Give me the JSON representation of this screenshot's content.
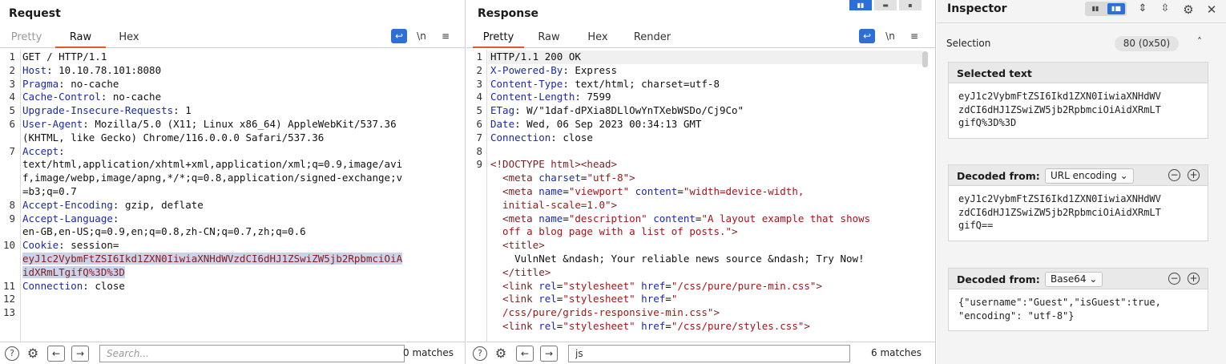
{
  "request": {
    "title": "Request",
    "tabs": [
      "Pretty",
      "Raw",
      "Hex"
    ],
    "active_tab": "Raw",
    "newline_label": "\\n",
    "lines": [
      {
        "n": "1",
        "segs": [
          {
            "t": "GET / HTTP/1.1",
            "c": ""
          }
        ]
      },
      {
        "n": "2",
        "segs": [
          {
            "t": "Host",
            "c": "hk"
          },
          {
            "t": ": 10.10.78.101:8080",
            "c": ""
          }
        ]
      },
      {
        "n": "3",
        "segs": [
          {
            "t": "Pragma",
            "c": "hk"
          },
          {
            "t": ": no-cache",
            "c": ""
          }
        ]
      },
      {
        "n": "4",
        "segs": [
          {
            "t": "Cache-Control",
            "c": "hk"
          },
          {
            "t": ": no-cache",
            "c": ""
          }
        ]
      },
      {
        "n": "5",
        "segs": [
          {
            "t": "Upgrade-Insecure-Requests",
            "c": "hk"
          },
          {
            "t": ": 1",
            "c": ""
          }
        ]
      },
      {
        "n": "6",
        "segs": [
          {
            "t": "User-Agent",
            "c": "hk"
          },
          {
            "t": ": Mozilla/5.0 (X11; Linux x86_64) AppleWebKit/537.36",
            "c": ""
          }
        ]
      },
      {
        "n": "",
        "segs": [
          {
            "t": "(KHTML, like Gecko) Chrome/116.0.0.0 Safari/537.36",
            "c": ""
          }
        ]
      },
      {
        "n": "7",
        "segs": [
          {
            "t": "Accept",
            "c": "hk"
          },
          {
            "t": ":",
            "c": ""
          }
        ]
      },
      {
        "n": "",
        "segs": [
          {
            "t": "text/html,application/xhtml+xml,application/xml;q=0.9,image/avi",
            "c": ""
          }
        ]
      },
      {
        "n": "",
        "segs": [
          {
            "t": "f,image/webp,image/apng,*/*;q=0.8,application/signed-exchange;v",
            "c": ""
          }
        ]
      },
      {
        "n": "",
        "segs": [
          {
            "t": "=b3;q=0.7",
            "c": ""
          }
        ]
      },
      {
        "n": "8",
        "segs": [
          {
            "t": "Accept-Encoding",
            "c": "hk"
          },
          {
            "t": ": gzip, deflate",
            "c": ""
          }
        ]
      },
      {
        "n": "9",
        "segs": [
          {
            "t": "Accept-Language",
            "c": "hk"
          },
          {
            "t": ":",
            "c": ""
          }
        ]
      },
      {
        "n": "",
        "segs": [
          {
            "t": "en-GB,en-US;q=0.9,en;q=0.8,zh-CN;q=0.7,zh;q=0.6",
            "c": ""
          }
        ]
      },
      {
        "n": "10",
        "segs": [
          {
            "t": "Cookie",
            "c": "hk"
          },
          {
            "t": ": session=",
            "c": ""
          }
        ]
      },
      {
        "n": "",
        "segs": [
          {
            "t": "eyJ1c2VybmFtZSI6Ikd1ZXN0IiwiaXNHdWVzdCI6dHJ1ZSwiZW5jb2RpbmciOiA",
            "c": "sel"
          }
        ]
      },
      {
        "n": "",
        "segs": [
          {
            "t": "idXRmLTgifQ%3D%3D",
            "c": "sel"
          }
        ]
      },
      {
        "n": "11",
        "segs": [
          {
            "t": "Connection",
            "c": "hk"
          },
          {
            "t": ": close",
            "c": ""
          }
        ]
      },
      {
        "n": "12",
        "segs": []
      },
      {
        "n": "13",
        "segs": []
      }
    ],
    "search_placeholder": "Search...",
    "search_value": "",
    "matches": "0 matches"
  },
  "response": {
    "title": "Response",
    "tabs": [
      "Pretty",
      "Raw",
      "Hex",
      "Render"
    ],
    "active_tab": "Pretty",
    "newline_label": "\\n",
    "lines": [
      {
        "n": "1",
        "segs": [
          {
            "t": "HTTP/1.1 200 OK",
            "c": ""
          }
        ]
      },
      {
        "n": "2",
        "segs": [
          {
            "t": "X-Powered-By",
            "c": "hk"
          },
          {
            "t": ": Express",
            "c": ""
          }
        ]
      },
      {
        "n": "3",
        "segs": [
          {
            "t": "Content-Type",
            "c": "hk"
          },
          {
            "t": ": text/html; charset=utf-8",
            "c": ""
          }
        ]
      },
      {
        "n": "4",
        "segs": [
          {
            "t": "Content-Length",
            "c": "hk"
          },
          {
            "t": ": 7599",
            "c": ""
          }
        ]
      },
      {
        "n": "5",
        "segs": [
          {
            "t": "ETag",
            "c": "hk"
          },
          {
            "t": ": W/\"1daf-dPXia8DLlOwYnTXebWSDo/Cj9Co\"",
            "c": ""
          }
        ]
      },
      {
        "n": "6",
        "segs": [
          {
            "t": "Date",
            "c": "hk"
          },
          {
            "t": ": Wed, 06 Sep 2023 00:34:13 GMT",
            "c": ""
          }
        ]
      },
      {
        "n": "7",
        "segs": [
          {
            "t": "Connection",
            "c": "hk"
          },
          {
            "t": ": close",
            "c": ""
          }
        ]
      },
      {
        "n": "8",
        "segs": []
      },
      {
        "n": "9",
        "segs": [
          {
            "t": "<!DOCTYPE html>",
            "c": "tag"
          },
          {
            "t": "<head>",
            "c": "tag"
          }
        ]
      },
      {
        "n": "",
        "segs": [
          {
            "t": "  <meta ",
            "c": "tag"
          },
          {
            "t": "charset",
            "c": "attr"
          },
          {
            "t": "=",
            "c": ""
          },
          {
            "t": "\"utf-8\"",
            "c": "aval"
          },
          {
            "t": ">",
            "c": "tag"
          }
        ]
      },
      {
        "n": "",
        "segs": [
          {
            "t": "  <meta ",
            "c": "tag"
          },
          {
            "t": "name",
            "c": "attr"
          },
          {
            "t": "=",
            "c": ""
          },
          {
            "t": "\"viewport\"",
            "c": "aval"
          },
          {
            "t": " content",
            "c": "attr"
          },
          {
            "t": "=",
            "c": ""
          },
          {
            "t": "\"width=device-width,",
            "c": "aval"
          }
        ]
      },
      {
        "n": "",
        "segs": [
          {
            "t": "  initial-scale=1.0\"",
            "c": "aval"
          },
          {
            "t": ">",
            "c": "tag"
          }
        ]
      },
      {
        "n": "",
        "segs": [
          {
            "t": "  <meta ",
            "c": "tag"
          },
          {
            "t": "name",
            "c": "attr"
          },
          {
            "t": "=",
            "c": ""
          },
          {
            "t": "\"description\"",
            "c": "aval"
          },
          {
            "t": " content",
            "c": "attr"
          },
          {
            "t": "=",
            "c": ""
          },
          {
            "t": "\"A layout example that shows",
            "c": "aval"
          }
        ]
      },
      {
        "n": "",
        "segs": [
          {
            "t": "  off a blog page with a list of posts.\"",
            "c": "aval"
          },
          {
            "t": ">",
            "c": "tag"
          }
        ]
      },
      {
        "n": "",
        "segs": [
          {
            "t": "  <title>",
            "c": "tag"
          }
        ]
      },
      {
        "n": "",
        "segs": [
          {
            "t": "    VulnNet &ndash; Your reliable news source &ndash; Try Now!",
            "c": ""
          }
        ]
      },
      {
        "n": "",
        "segs": [
          {
            "t": "  </title>",
            "c": "tag"
          }
        ]
      },
      {
        "n": "",
        "segs": [
          {
            "t": "  <link ",
            "c": "tag"
          },
          {
            "t": "rel",
            "c": "attr"
          },
          {
            "t": "=",
            "c": ""
          },
          {
            "t": "\"stylesheet\"",
            "c": "aval"
          },
          {
            "t": " href",
            "c": "attr"
          },
          {
            "t": "=",
            "c": ""
          },
          {
            "t": "\"/css/pure/pure-min.css\"",
            "c": "aval"
          },
          {
            "t": ">",
            "c": "tag"
          }
        ]
      },
      {
        "n": "",
        "segs": [
          {
            "t": "  <link ",
            "c": "tag"
          },
          {
            "t": "rel",
            "c": "attr"
          },
          {
            "t": "=",
            "c": ""
          },
          {
            "t": "\"stylesheet\"",
            "c": "aval"
          },
          {
            "t": " href",
            "c": "attr"
          },
          {
            "t": "=",
            "c": ""
          },
          {
            "t": "\"",
            "c": "aval"
          }
        ]
      },
      {
        "n": "",
        "segs": [
          {
            "t": "  /css/pure/grids-responsive-min.css\"",
            "c": "aval"
          },
          {
            "t": ">",
            "c": "tag"
          }
        ]
      },
      {
        "n": "",
        "segs": [
          {
            "t": "  <link ",
            "c": "tag"
          },
          {
            "t": "rel",
            "c": "attr"
          },
          {
            "t": "=",
            "c": ""
          },
          {
            "t": "\"stylesheet\"",
            "c": "aval"
          },
          {
            "t": " href",
            "c": "attr"
          },
          {
            "t": "=",
            "c": ""
          },
          {
            "t": "\"/css/pure/styles.css\"",
            "c": "aval"
          },
          {
            "t": ">",
            "c": "tag"
          }
        ]
      }
    ],
    "search_value": "js",
    "matches": "6 matches"
  },
  "inspector": {
    "title": "Inspector",
    "selection_label": "Selection",
    "selection_value": "80 (0x50)",
    "selected_text_label": "Selected text",
    "selected_text": "eyJ1c2VybmFtZSI6Ikd1ZXN0IiwiaXNHdWV\nzdCI6dHJ1ZSwiZW5jb2RpbmciOiAidXRmLT\ngifQ%3D%3D",
    "decoded_blocks": [
      {
        "label": "Decoded from:",
        "encoding": "URL encoding",
        "value": "eyJ1c2VybmFtZSI6Ikd1ZXN0IiwiaXNHdWV\nzdCI6dHJ1ZSwiZW5jb2RpbmciOiAidXRmLT\ngifQ=="
      },
      {
        "label": "Decoded from:",
        "encoding": "Base64",
        "value": "{\"username\":\"Guest\",\"isGuest\":true,\n\"encoding\": \"utf-8\"}"
      }
    ]
  },
  "icons": {
    "help": "?",
    "settings": "⚙",
    "back": "←",
    "forward": "→",
    "menu": "≡",
    "wrap": "↩",
    "chevron_down": "⌄",
    "chevron_up": "˄",
    "close": "✕",
    "minus": "−",
    "plus": "+",
    "expand": "⇕",
    "collapse": "⇳"
  }
}
